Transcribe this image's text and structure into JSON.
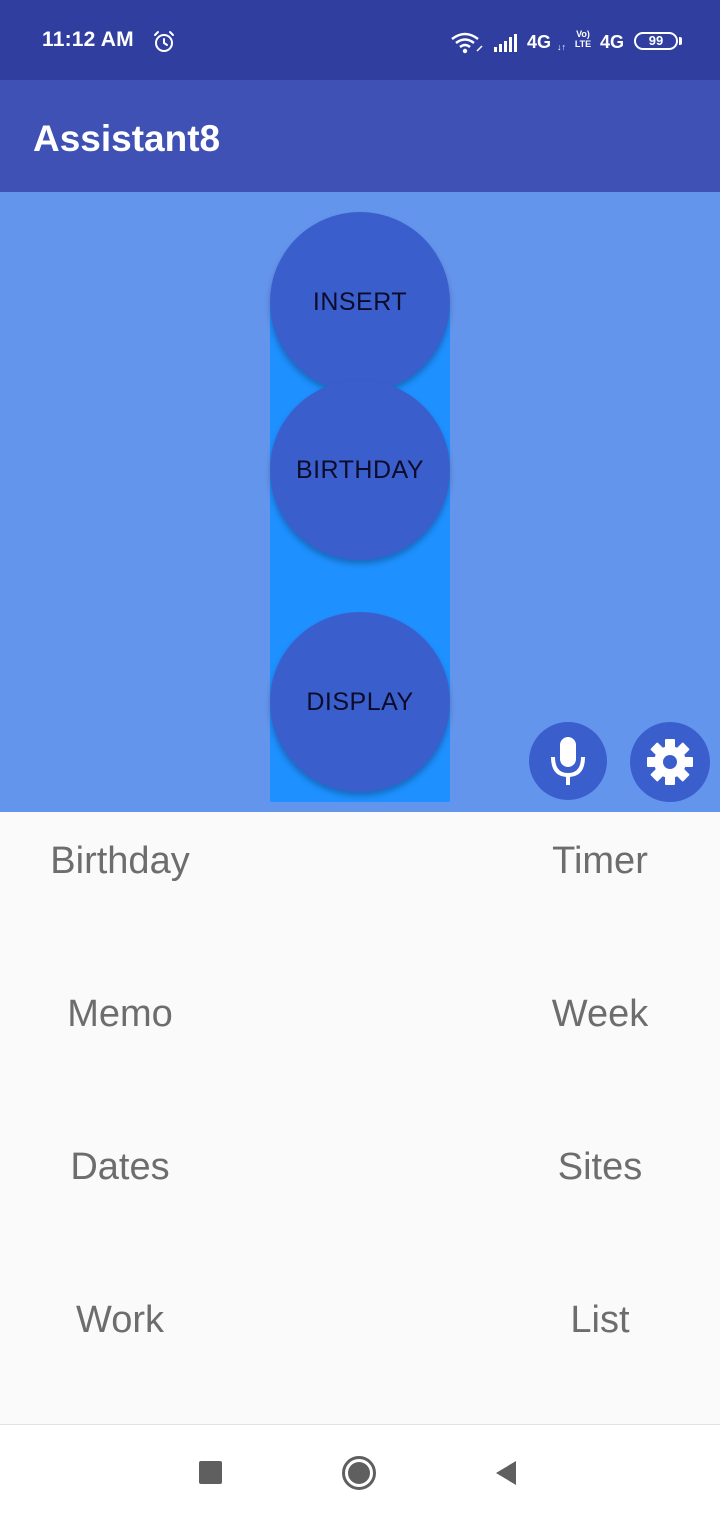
{
  "status_bar": {
    "time": "11:12 AM",
    "network1": "4G",
    "network1_arrows": "↓↑",
    "volte_line1": "Vo)",
    "volte_line2": "LTE",
    "network2": "4G",
    "battery": "99",
    "icons": [
      "alarm-icon",
      "wifi-icon",
      "signal-icon",
      "battery-icon"
    ]
  },
  "app_bar": {
    "title": "Assistant8"
  },
  "panel": {
    "buttons": [
      {
        "label": "INSERT"
      },
      {
        "label": "BIRTHDAY"
      },
      {
        "label": "DISPLAY"
      }
    ],
    "fabs": [
      "microphone-icon",
      "gear-icon"
    ]
  },
  "menu": {
    "items": [
      {
        "label": "Birthday"
      },
      {
        "label": "Timer"
      },
      {
        "label": "Memo"
      },
      {
        "label": "Week"
      },
      {
        "label": "Dates"
      },
      {
        "label": "Sites"
      },
      {
        "label": "Work"
      },
      {
        "label": "List"
      }
    ]
  },
  "nav_bar": {
    "icons": [
      "recents-icon",
      "home-icon",
      "back-icon"
    ]
  },
  "colors": {
    "status_bar": "#303f9f",
    "app_bar": "#3f51b5",
    "panel": "#6495ed",
    "column": "#1e90ff",
    "circle_button": "#3a5fcd",
    "menu_text": "#6d6d6d"
  }
}
